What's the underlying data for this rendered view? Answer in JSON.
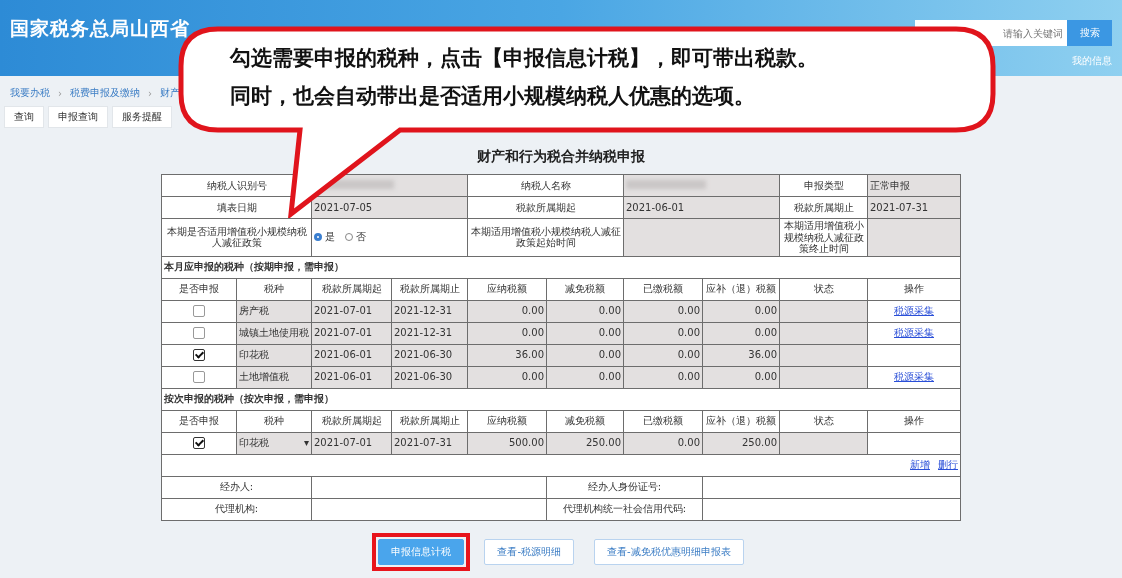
{
  "header": {
    "site_title": "国家税务总局山西省",
    "search": {
      "placeholder": "请输入关键词"
    },
    "search_button": "搜索",
    "user_link": "我的信息"
  },
  "breadcrumb": [
    {
      "kind": "link",
      "text": "我要办税"
    },
    {
      "kind": "separator",
      "text": "›"
    },
    {
      "kind": "link",
      "text": "税费申报及缴纳"
    },
    {
      "kind": "separator",
      "text": "›"
    },
    {
      "kind": "link",
      "text": "财产"
    }
  ],
  "tabs": [
    {
      "label": "查询",
      "selected": false
    },
    {
      "label": "申报查询",
      "selected": false
    },
    {
      "label": "服务提醒",
      "selected": false
    }
  ],
  "form": {
    "title": "财产和行为税合并纳税申报",
    "info_rows": [
      [
        {
          "kind": "label",
          "text": "纳税人识别号"
        },
        {
          "kind": "redacted"
        },
        {
          "kind": "label",
          "text": "纳税人名称"
        },
        {
          "kind": "redacted"
        },
        {
          "kind": "label",
          "text": "申报类型"
        },
        {
          "kind": "value",
          "text": "正常申报"
        }
      ],
      [
        {
          "kind": "label",
          "text": "填表日期"
        },
        {
          "kind": "value",
          "text": "2021-07-05"
        },
        {
          "kind": "label",
          "text": "税款所属期起"
        },
        {
          "kind": "value",
          "text": "2021-06-01"
        },
        {
          "kind": "label",
          "text": "税款所属期止"
        },
        {
          "kind": "value",
          "text": "2021-07-31"
        }
      ],
      [
        {
          "kind": "label",
          "text": "本期是否适用增值税小规模纳税人减征政策"
        },
        {
          "kind": "radio",
          "options": [
            {
              "label": "是",
              "selected": true
            },
            {
              "label": "否",
              "selected": false
            }
          ]
        },
        {
          "kind": "label",
          "text": "本期适用增值税小规模纳税人减征政策起始时间"
        },
        {
          "kind": "value"
        },
        {
          "kind": "label",
          "text": "本期适用增值税小规模纳税人减征政策终止时间"
        },
        {
          "kind": "value"
        }
      ]
    ],
    "sections": [
      {
        "title": "本月应申报的税种（按期申报，需申报）",
        "columns": [
          "是否申报",
          "税种",
          "税款所属期起",
          "税款所属期止",
          "应纳税额",
          "减免税额",
          "已缴税额",
          "应补（退）税额",
          "状态",
          "操作"
        ],
        "rows": [
          {
            "checked": false,
            "kind": "fixed",
            "tax": "房产税",
            "start": "2021-07-01",
            "end": "2021-12-31",
            "payable": "0.00",
            "reduced": "0.00",
            "paid": "0.00",
            "due": "0.00",
            "action": "税源采集"
          },
          {
            "checked": false,
            "kind": "fixed",
            "tax": "城镇土地使用税",
            "start": "2021-07-01",
            "end": "2021-12-31",
            "payable": "0.00",
            "reduced": "0.00",
            "paid": "0.00",
            "due": "0.00",
            "action": "税源采集"
          },
          {
            "checked": true,
            "kind": "fixed",
            "tax": "印花税",
            "start": "2021-06-01",
            "end": "2021-06-30",
            "payable": "36.00",
            "reduced": "0.00",
            "paid": "0.00",
            "due": "36.00"
          },
          {
            "checked": false,
            "kind": "fixed",
            "tax": "土地增值税",
            "start": "2021-06-01",
            "end": "2021-06-30",
            "payable": "0.00",
            "reduced": "0.00",
            "paid": "0.00",
            "due": "0.00",
            "action": "税源采集"
          }
        ]
      },
      {
        "title": "按次申报的税种（按次申报，需申报）",
        "columns": [
          "是否申报",
          "税种",
          "税款所属期起",
          "税款所属期止",
          "应纳税额",
          "减免税额",
          "已缴税额",
          "应补（退）税额",
          "状态",
          "操作"
        ],
        "rows": [
          {
            "checked": true,
            "kind": "select",
            "tax": "印花税",
            "dropdown": "▾",
            "start": "2021-07-01",
            "end": "2021-07-31",
            "payable": "500.00",
            "reduced": "250.00",
            "paid": "0.00",
            "due": "250.00"
          }
        ],
        "links": [
          "新增",
          "删行"
        ]
      }
    ],
    "signers": [
      [
        {
          "label": "经办人:"
        },
        {
          "label": "经办人身份证号:"
        }
      ],
      [
        {
          "label": "代理机构:"
        },
        {
          "label": "代理机构统一社会信用代码:"
        }
      ]
    ],
    "buttons": [
      {
        "label": "申报信息计税",
        "primary": true,
        "highlighted": true
      },
      {
        "label": "查看-税源明细",
        "primary": false,
        "highlighted": false
      },
      {
        "label": "查看-减免税优惠明细申报表",
        "primary": false,
        "highlighted": false
      }
    ]
  },
  "callout": {
    "lines": [
      "勾选需要申报的税种，点击【申报信息计税】，即可带出税款。",
      "同时，也会自动带出是否适用小规模纳税人优惠的选项。"
    ]
  }
}
